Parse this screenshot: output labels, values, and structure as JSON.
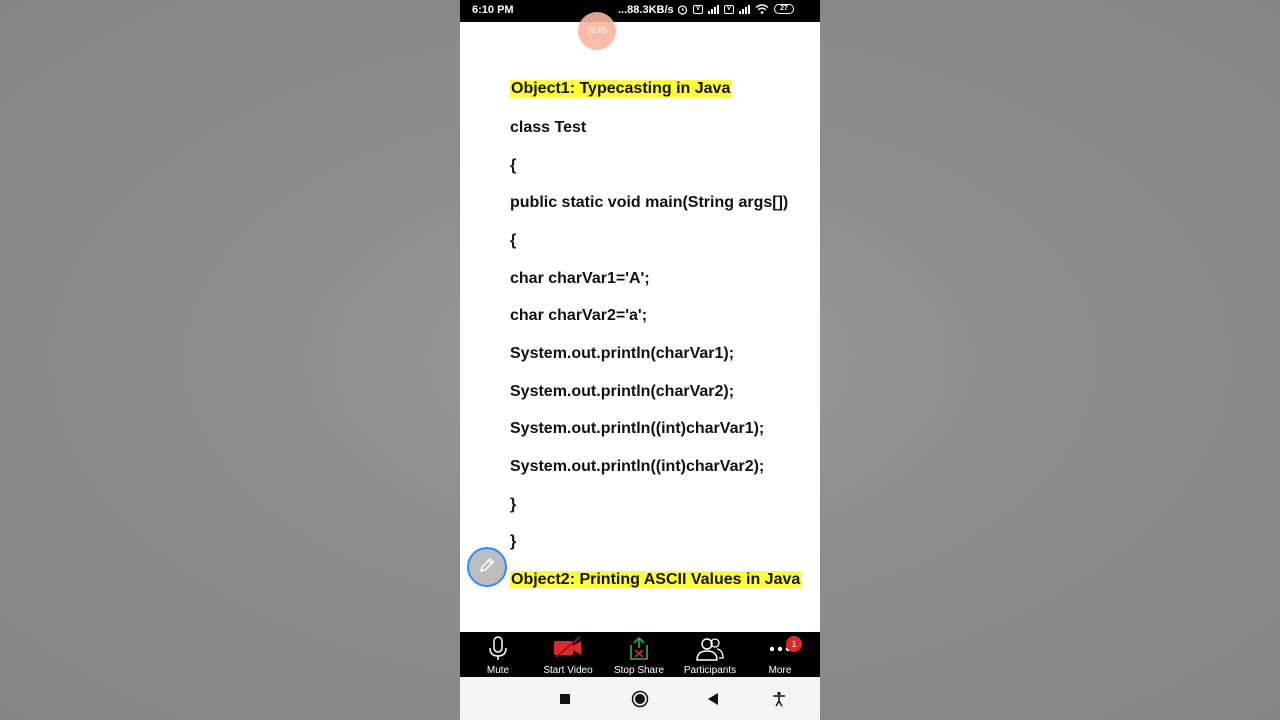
{
  "status_bar": {
    "time": "6:10 PM",
    "network_speed": "...88.3KB/s",
    "battery": "27",
    "icons": [
      "alarm-icon",
      "volte-icon",
      "signal-4g-icon",
      "volte-icon",
      "signal-icon",
      "wifi-icon",
      "battery-icon"
    ]
  },
  "recording": {
    "timer": "00:05"
  },
  "document": {
    "lines": [
      "Object1: Typecasting in Java",
      "class Test",
      "{",
      "public static void main(String args[])",
      "{",
      "char charVar1='A';",
      "char charVar2='a';",
      "System.out.println(charVar1);",
      "System.out.println(charVar2);",
      "System.out.println((int)charVar1);",
      "System.out.println((int)charVar2);",
      "}",
      "}",
      "Object2: Printing ASCII Values in Java"
    ],
    "highlight_color": "#ffff2e"
  },
  "toolbar": {
    "mute_label": "Mute",
    "start_video_label": "Start Video",
    "stop_share_label": "Stop Share",
    "participants_label": "Participants",
    "more_label": "More",
    "more_badge": "1",
    "accent_red": "#e02828",
    "accent_green": "#2bb34a"
  },
  "nav": {
    "icons": [
      "recents-square-icon",
      "home-circle-icon",
      "back-triangle-icon",
      "accessibility-icon"
    ]
  }
}
